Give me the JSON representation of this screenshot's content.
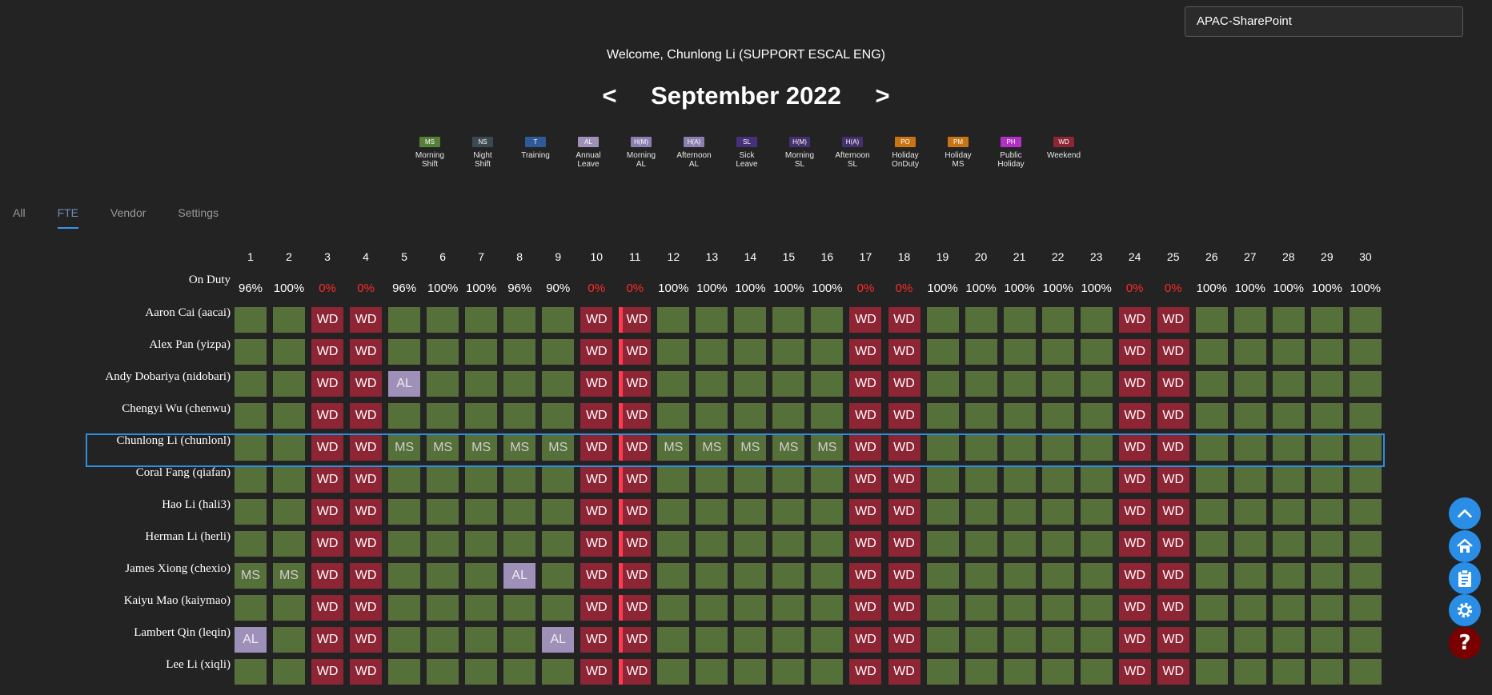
{
  "site_selector": {
    "value": "APAC-SharePoint"
  },
  "welcome": "Welcome, Chunlong Li (SUPPORT ESCAL ENG)",
  "nav": {
    "prev": "<",
    "next": ">",
    "month_title": "September 2022"
  },
  "legend": [
    {
      "code": "MS",
      "label_line1": "Morning",
      "label_line2": "Shift",
      "color": "#56803a"
    },
    {
      "code": "NS",
      "label_line1": "Night",
      "label_line2": "Shift",
      "color": "#3b4a52"
    },
    {
      "code": "T",
      "label_line1": "Training",
      "label_line2": "",
      "color": "#2f5a98"
    },
    {
      "code": "AL",
      "label_line1": "Annual",
      "label_line2": "Leave",
      "color": "#9e90b8"
    },
    {
      "code": "H(M)",
      "label_line1": "Morning",
      "label_line2": "AL",
      "color": "#8c7fb0"
    },
    {
      "code": "H(A)",
      "label_line1": "Afternoon",
      "label_line2": "AL",
      "color": "#8c7fb0"
    },
    {
      "code": "SL",
      "label_line1": "Sick",
      "label_line2": "Leave",
      "color": "#46307a"
    },
    {
      "code": "H(M)",
      "label_line1": "Morning",
      "label_line2": "SL",
      "color": "#45306e"
    },
    {
      "code": "H(A)",
      "label_line1": "Afternoon",
      "label_line2": "SL",
      "color": "#45306e"
    },
    {
      "code": "PO",
      "label_line1": "Holiday",
      "label_line2": "OnDuty",
      "color": "#c87414"
    },
    {
      "code": "PM",
      "label_line1": "Holiday",
      "label_line2": "MS",
      "color": "#c87414"
    },
    {
      "code": "PH",
      "label_line1": "Public",
      "label_line2": "Holiday",
      "color": "#b32fc6"
    },
    {
      "code": "WD",
      "label_line1": "Weekend",
      "label_line2": "",
      "color": "#8e2534"
    }
  ],
  "tabs": [
    {
      "label": "All",
      "active": false
    },
    {
      "label": "FTE",
      "active": true
    },
    {
      "label": "Vendor",
      "active": false
    },
    {
      "label": "Settings",
      "active": false
    }
  ],
  "on_duty_label": "On Duty",
  "days": [
    "1",
    "2",
    "3",
    "4",
    "5",
    "6",
    "7",
    "8",
    "9",
    "10",
    "11",
    "12",
    "13",
    "14",
    "15",
    "16",
    "17",
    "18",
    "19",
    "20",
    "21",
    "22",
    "23",
    "24",
    "25",
    "26",
    "27",
    "28",
    "29",
    "30"
  ],
  "on_duty": [
    "96%",
    "100%",
    "0%",
    "0%",
    "96%",
    "100%",
    "100%",
    "96%",
    "90%",
    "0%",
    "0%",
    "100%",
    "100%",
    "100%",
    "100%",
    "100%",
    "0%",
    "0%",
    "100%",
    "100%",
    "100%",
    "100%",
    "100%",
    "0%",
    "0%",
    "100%",
    "100%",
    "100%",
    "100%",
    "100%"
  ],
  "colors": {
    "work": "#56703a",
    "weekend": "#8e2534",
    "leave": "#9e90b8",
    "ms_text": "#cfcfcf",
    "zero_pct": "#ff2a2a",
    "holiday_marker": "#ff3b4e",
    "highlight": "#2d8fe0"
  },
  "employees": [
    {
      "name": "Aaron Cai (aacai)",
      "cells": [
        "",
        "",
        "WD",
        "WD",
        "",
        "",
        "",
        "",
        "",
        "WD",
        "WD",
        "",
        "",
        "",
        "",
        "",
        "WD",
        "WD",
        "",
        "",
        "",
        "",
        "",
        "WD",
        "WD",
        "",
        "",
        "",
        "",
        ""
      ]
    },
    {
      "name": "Alex Pan (yizpa)",
      "cells": [
        "",
        "",
        "WD",
        "WD",
        "",
        "",
        "",
        "",
        "",
        "WD",
        "WD",
        "",
        "",
        "",
        "",
        "",
        "WD",
        "WD",
        "",
        "",
        "",
        "",
        "",
        "WD",
        "WD",
        "",
        "",
        "",
        "",
        ""
      ]
    },
    {
      "name": "Andy Dobariya (nidobari)",
      "cells": [
        "",
        "",
        "WD",
        "WD",
        "AL",
        "",
        "",
        "",
        "",
        "WD",
        "WD",
        "",
        "",
        "",
        "",
        "",
        "WD",
        "WD",
        "",
        "",
        "",
        "",
        "",
        "WD",
        "WD",
        "",
        "",
        "",
        "",
        ""
      ]
    },
    {
      "name": "Chengyi Wu (chenwu)",
      "cells": [
        "",
        "",
        "WD",
        "WD",
        "",
        "",
        "",
        "",
        "",
        "WD",
        "WD",
        "",
        "",
        "",
        "",
        "",
        "WD",
        "WD",
        "",
        "",
        "",
        "",
        "",
        "WD",
        "WD",
        "",
        "",
        "",
        "",
        ""
      ]
    },
    {
      "name": "Chunlong Li (chunlonl)",
      "highlighted": true,
      "cells": [
        "",
        "",
        "WD",
        "WD",
        "MS",
        "MS",
        "MS",
        "MS",
        "MS",
        "WD",
        "WD",
        "MS",
        "MS",
        "MS",
        "MS",
        "MS",
        "WD",
        "WD",
        "",
        "",
        "",
        "",
        "",
        "WD",
        "WD",
        "",
        "",
        "",
        "",
        ""
      ]
    },
    {
      "name": "Coral Fang (qiafan)",
      "cells": [
        "",
        "",
        "WD",
        "WD",
        "",
        "",
        "",
        "",
        "",
        "WD",
        "WD",
        "",
        "",
        "",
        "",
        "",
        "WD",
        "WD",
        "",
        "",
        "",
        "",
        "",
        "WD",
        "WD",
        "",
        "",
        "",
        "",
        ""
      ]
    },
    {
      "name": "Hao Li (hali3)",
      "cells": [
        "",
        "",
        "WD",
        "WD",
        "",
        "",
        "",
        "",
        "",
        "WD",
        "WD",
        "",
        "",
        "",
        "",
        "",
        "WD",
        "WD",
        "",
        "",
        "",
        "",
        "",
        "WD",
        "WD",
        "",
        "",
        "",
        "",
        ""
      ]
    },
    {
      "name": "Herman Li (herli)",
      "cells": [
        "",
        "",
        "WD",
        "WD",
        "",
        "",
        "",
        "",
        "",
        "WD",
        "WD",
        "",
        "",
        "",
        "",
        "",
        "WD",
        "WD",
        "",
        "",
        "",
        "",
        "",
        "WD",
        "WD",
        "",
        "",
        "",
        "",
        ""
      ]
    },
    {
      "name": "James Xiong (chexio)",
      "cells": [
        "MS",
        "MS",
        "WD",
        "WD",
        "",
        "",
        "",
        "AL",
        "",
        "WD",
        "WD",
        "",
        "",
        "",
        "",
        "",
        "WD",
        "WD",
        "",
        "",
        "",
        "",
        "",
        "WD",
        "WD",
        "",
        "",
        "",
        "",
        ""
      ]
    },
    {
      "name": "Kaiyu Mao (kaiymao)",
      "cells": [
        "",
        "",
        "WD",
        "WD",
        "",
        "",
        "",
        "",
        "",
        "WD",
        "WD",
        "",
        "",
        "",
        "",
        "",
        "WD",
        "WD",
        "",
        "",
        "",
        "",
        "",
        "WD",
        "WD",
        "",
        "",
        "",
        "",
        ""
      ]
    },
    {
      "name": "Lambert Qin (leqin)",
      "cells": [
        "AL",
        "",
        "WD",
        "WD",
        "",
        "",
        "",
        "",
        "AL",
        "WD",
        "WD",
        "",
        "",
        "",
        "",
        "",
        "WD",
        "WD",
        "",
        "",
        "",
        "",
        "",
        "WD",
        "WD",
        "",
        "",
        "",
        "",
        ""
      ]
    },
    {
      "name": "Lee Li (xiqli)",
      "cells": [
        "",
        "",
        "WD",
        "WD",
        "",
        "",
        "",
        "",
        "",
        "WD",
        "WD",
        "",
        "",
        "",
        "",
        "",
        "WD",
        "WD",
        "",
        "",
        "",
        "",
        "",
        "WD",
        "WD",
        "",
        "",
        "",
        "",
        ""
      ]
    }
  ],
  "fab": [
    {
      "icon": "chevron-up-icon",
      "color": "#2a8ee6"
    },
    {
      "icon": "home-icon",
      "color": "#2a8ee6"
    },
    {
      "icon": "clipboard-icon",
      "color": "#2a8ee6"
    },
    {
      "icon": "gear-icon",
      "color": "#2a8ee6"
    },
    {
      "icon": "help-icon",
      "glyph": "?",
      "color": "#7a0000"
    }
  ]
}
